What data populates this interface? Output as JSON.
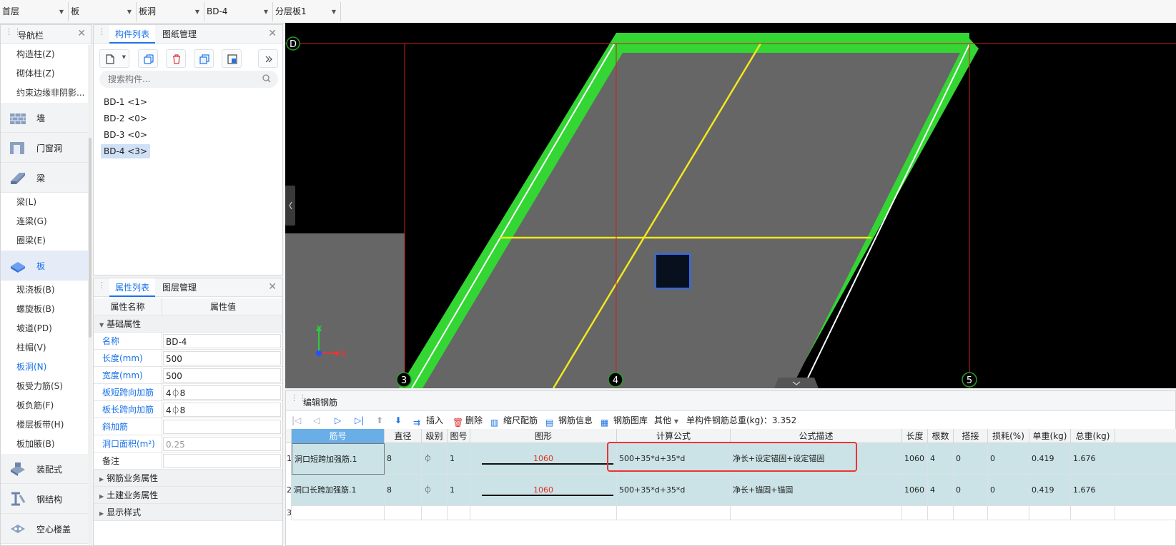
{
  "topbar": {
    "dropdowns": [
      "首层",
      "板",
      "板洞",
      "BD-4",
      "分层板1"
    ]
  },
  "nav": {
    "title": "导航栏",
    "items": [
      {
        "type": "sub",
        "label": "构造柱(Z)"
      },
      {
        "type": "sub",
        "label": "砌体柱(Z)"
      },
      {
        "type": "sub",
        "label": "约束边缘非阴影..."
      },
      {
        "type": "cat",
        "label": "墙",
        "icon": "wall-icon"
      },
      {
        "type": "cat",
        "label": "门窗洞",
        "icon": "door-window-icon"
      },
      {
        "type": "cat",
        "label": "梁",
        "icon": "beam-icon"
      },
      {
        "type": "sub",
        "label": "梁(L)"
      },
      {
        "type": "sub",
        "label": "连梁(G)"
      },
      {
        "type": "sub",
        "label": "圈梁(E)"
      },
      {
        "type": "cat",
        "label": "板",
        "icon": "slab-icon",
        "selected": true
      },
      {
        "type": "sub",
        "label": "现浇板(B)"
      },
      {
        "type": "sub",
        "label": "螺旋板(B)"
      },
      {
        "type": "sub",
        "label": "坡道(PD)"
      },
      {
        "type": "sub",
        "label": "柱帽(V)"
      },
      {
        "type": "sub",
        "label": "板洞(N)",
        "active": true
      },
      {
        "type": "sub",
        "label": "板受力筋(S)"
      },
      {
        "type": "sub",
        "label": "板负筋(F)"
      },
      {
        "type": "sub",
        "label": "楼层板带(H)"
      },
      {
        "type": "sub",
        "label": "板加腋(B)"
      },
      {
        "type": "cat",
        "label": "装配式",
        "icon": "prefab-icon"
      },
      {
        "type": "cat",
        "label": "钢结构",
        "icon": "steel-icon"
      },
      {
        "type": "cat",
        "label": "空心楼盖",
        "icon": "hollow-floor-icon"
      }
    ]
  },
  "components": {
    "tab_active": "构件列表",
    "tab_other": "图纸管理",
    "search_placeholder": "搜索构件...",
    "items": [
      "BD-1 <1>",
      "BD-2 <0>",
      "BD-3 <0>",
      "BD-4 <3>"
    ],
    "selected_index": 3
  },
  "properties": {
    "tab_active": "属性列表",
    "tab_other": "图层管理",
    "col_name": "属性名称",
    "col_value": "属性值",
    "group_basic": "基础属性",
    "rows": [
      {
        "name": "名称",
        "value": "BD-4",
        "blue": true
      },
      {
        "name": "长度(mm)",
        "value": "500",
        "blue": true
      },
      {
        "name": "宽度(mm)",
        "value": "500",
        "blue": true
      },
      {
        "name": "板短跨向加筋",
        "value": "4⏀8",
        "blue": true
      },
      {
        "name": "板长跨向加筋",
        "value": "4⏀8",
        "blue": true
      },
      {
        "name": "斜加筋",
        "value": "",
        "blue": true
      },
      {
        "name": "洞口面积(m²)",
        "value": "0.25",
        "blue": true,
        "disabled": true
      },
      {
        "name": "备注",
        "value": "",
        "blue": false
      }
    ],
    "groups_collapsed": [
      "钢筋业务属性",
      "土建业务属性",
      "显示样式"
    ]
  },
  "canvas": {
    "axis_top": "D",
    "axis_bottom": [
      "3",
      "4",
      "5"
    ],
    "axis_x": "X",
    "axis_y": "Y"
  },
  "rebar": {
    "title": "编辑钢筋",
    "tools": {
      "insert": "插入",
      "delete": "删除",
      "scale_config": "缩尺配筋",
      "rebar_info": "钢筋信息",
      "rebar_lib": "钢筋图库",
      "other": "其他",
      "total_weight": "单构件钢筋总重(kg)：3.352"
    },
    "columns": [
      "筋号",
      "直径(mm)",
      "级别",
      "图号",
      "图形",
      "计算公式",
      "公式描述",
      "长度",
      "根数",
      "搭接",
      "损耗(%)",
      "单重(kg)",
      "总重(kg)"
    ],
    "rows": [
      {
        "num": "1",
        "name": "洞口短跨加强筋.1",
        "dia": "8",
        "grade": "⏀",
        "fig": "1",
        "shape": "1060",
        "formula": "500+35*d+35*d",
        "desc": "净长+设定锚固+设定锚固",
        "len": "1060",
        "count": "4",
        "lap": "0",
        "loss": "0",
        "unit": "0.419",
        "total": "1.676"
      },
      {
        "num": "2",
        "name": "洞口长跨加强筋.1",
        "dia": "8",
        "grade": "⏀",
        "fig": "1",
        "shape": "1060",
        "formula": "500+35*d+35*d",
        "desc": "净长+锚固+锚固",
        "len": "1060",
        "count": "4",
        "lap": "0",
        "loss": "0",
        "unit": "0.419",
        "total": "1.676"
      }
    ],
    "empty_row_num": "3"
  },
  "colors": {
    "accent": "#1a73e8",
    "slab_green": "#33d633",
    "slab_gray": "#666666",
    "axis_red": "#cc1f1f",
    "grid_yellow": "#f2e81c",
    "hole": "#08101e",
    "row_bg": "#cbe3e6"
  }
}
